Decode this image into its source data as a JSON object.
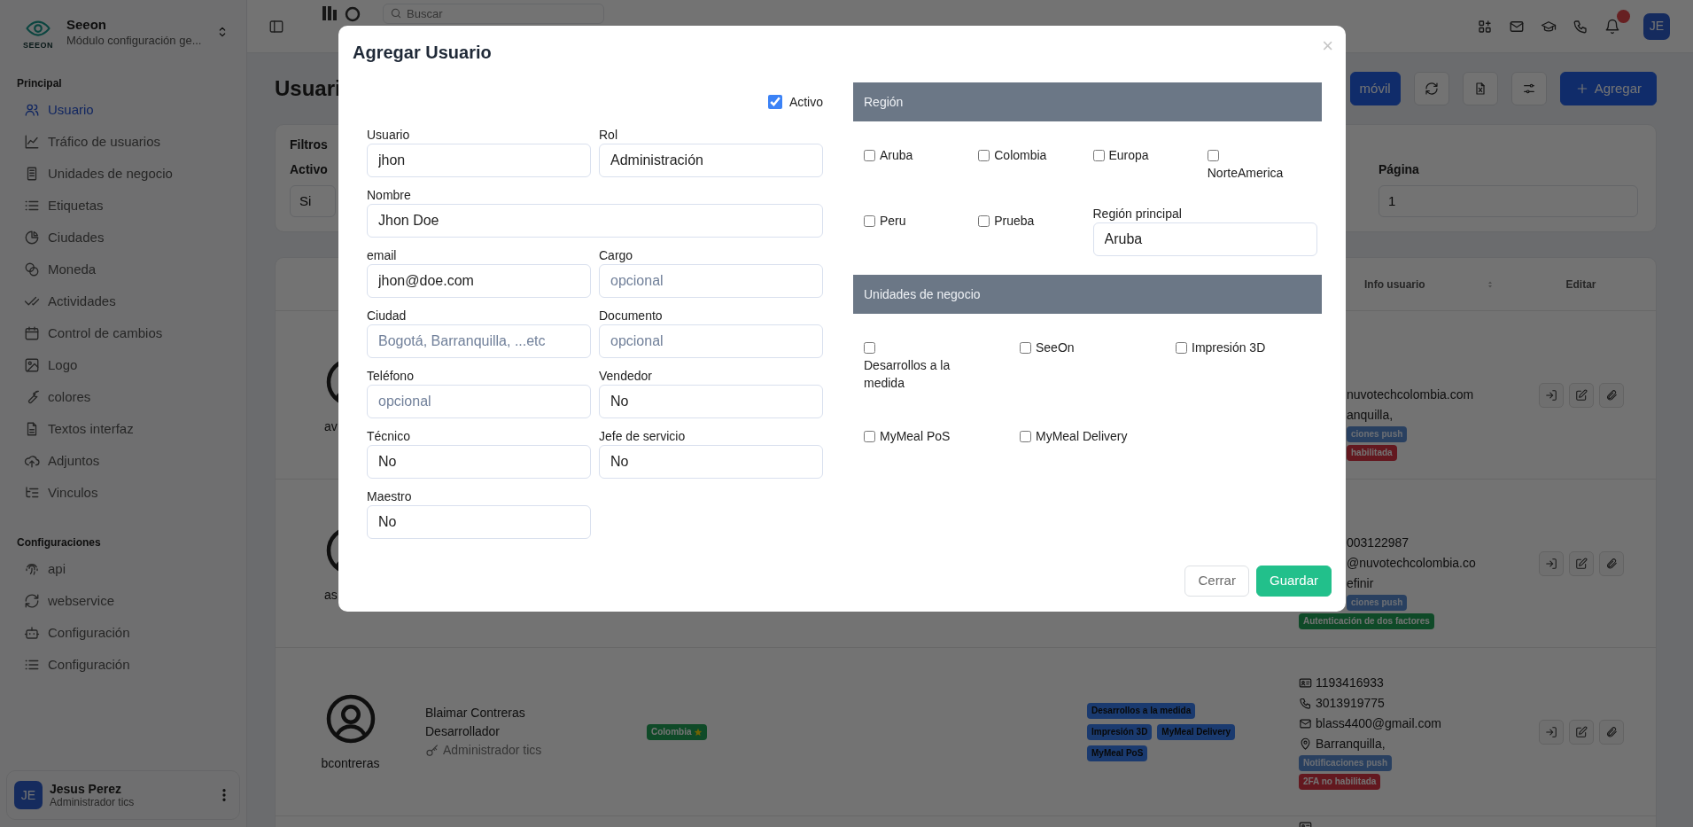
{
  "sidebar": {
    "brand": {
      "logo_text": "SEEON",
      "title": "Seeon",
      "subtitle": "Módulo configuración ge..."
    },
    "sections": [
      {
        "title": "Principal",
        "items": [
          {
            "label": "Usuario",
            "selected": true
          },
          {
            "label": "Tráfico de usuarios",
            "selected": false
          },
          {
            "label": "Unidades de negocio",
            "selected": false
          },
          {
            "label": "Etiquetas",
            "selected": false
          },
          {
            "label": "Ciudades",
            "selected": false
          },
          {
            "label": "Moneda",
            "selected": false
          },
          {
            "label": "Actividades",
            "selected": false
          },
          {
            "label": "Control de cambios",
            "selected": false
          },
          {
            "label": "Logo",
            "selected": false
          },
          {
            "label": "colores",
            "selected": false
          },
          {
            "label": "Textos interfaz",
            "selected": false
          },
          {
            "label": "Adjuntos",
            "selected": false
          },
          {
            "label": "Vinculos",
            "selected": false
          }
        ]
      },
      {
        "title": "Configuraciones",
        "items": [
          {
            "label": "api",
            "selected": false
          },
          {
            "label": "webservice",
            "selected": false
          },
          {
            "label": "Configuración",
            "selected": false
          },
          {
            "label": "Configuración",
            "selected": false
          }
        ]
      }
    ],
    "user": {
      "initials": "JE",
      "name": "Jesus Perez",
      "role": "Administrador tics"
    }
  },
  "topbar": {
    "search": {
      "placeholder": "Buscar"
    },
    "avatar": "JE"
  },
  "page": {
    "title": "Usuari",
    "buttons": [
      {
        "kind": "primary",
        "label": "móvil"
      },
      {
        "kind": "refresh"
      },
      {
        "kind": "excel"
      },
      {
        "kind": "settings"
      },
      {
        "kind": "add",
        "label": "Agregar"
      }
    ]
  },
  "filters": {
    "title": "Filtros",
    "fields": [
      {
        "label": "Activo",
        "value": "Si"
      },
      {
        "label": "Página",
        "value": "1"
      }
    ]
  },
  "table": {
    "columns": [
      {
        "label": "Info usuario",
        "sortable": true
      },
      {
        "label": "Editar",
        "sortable": false
      }
    ],
    "rows": [
      {
        "kind": "covered",
        "username": "av",
        "info": [
          {
            "text": "nuvotechcolombia.com",
            "cut": true
          },
          {
            "text": "anquilla,",
            "cut": true
          }
        ],
        "badges": [
          {
            "text": "ciones push",
            "kind": "info",
            "cut": true
          },
          {
            "text": "habilitada",
            "kind": "danger",
            "cut": true
          }
        ]
      },
      {
        "kind": "covered",
        "username": "as",
        "info": [
          {
            "text": "003122987",
            "cut": true
          },
          {
            "text": "@nuvotechcolombia.co",
            "cut": true
          },
          {
            "text": "efinir",
            "cut": true
          }
        ],
        "badges": [
          {
            "text": "ciones push",
            "kind": "info",
            "cut": true
          },
          {
            "text": "Autenticación de dos factores",
            "kind": "success"
          }
        ]
      },
      {
        "kind": "full",
        "username": "bcontreras",
        "name": "Blaimar Contreras",
        "position": "Desarrollador",
        "role": "Administrador tics",
        "regions": [
          {
            "label": "Colombia",
            "primary": true
          }
        ],
        "units": [
          "Desarrollos a la medida",
          "Impresión 3D",
          "MyMeal Delivery",
          "MyMeal PoS"
        ],
        "info": [
          {
            "kind": "document",
            "text": "1193416933"
          },
          {
            "kind": "phone",
            "text": "3013919775"
          },
          {
            "kind": "email",
            "text": "blass4400@gmail.com"
          },
          {
            "kind": "location",
            "text": "Barranquilla,"
          }
        ],
        "badges": [
          {
            "text": "Notificaciones push",
            "kind": "info"
          },
          {
            "text": "2FA no habilitada",
            "kind": "danger"
          }
        ]
      },
      {
        "kind": "clipped",
        "info": [
          {
            "kind": "document"
          }
        ]
      }
    ]
  },
  "modal": {
    "title": "Agregar Usuario",
    "close": "×",
    "active": {
      "label": "Activo",
      "checked": true
    },
    "fields": [
      {
        "label": "Usuario",
        "value": "jhon"
      },
      {
        "label": "Rol",
        "value": "Administración"
      },
      {
        "label": "Nombre",
        "value": "Jhon Doe",
        "wide": true
      },
      {
        "label": "email",
        "value": "jhon@doe.com"
      },
      {
        "label": "Cargo",
        "placeholder": "opcional"
      },
      {
        "label": "Ciudad",
        "placeholder": "Bogotá, Barranquilla, ...etc"
      },
      {
        "label": "Documento",
        "placeholder": "opcional"
      },
      {
        "label": "Teléfono",
        "placeholder": "opcional"
      },
      {
        "label": "Vendedor",
        "value": "No"
      },
      {
        "label": "Técnico",
        "value": "No"
      },
      {
        "label": "Jefe de servicio",
        "value": "No"
      },
      {
        "label": "Maestro",
        "value": "No"
      }
    ],
    "region": {
      "title": "Región",
      "options": [
        {
          "label": "Aruba",
          "checked": false
        },
        {
          "label": "Colombia",
          "checked": false
        },
        {
          "label": "Europa",
          "checked": false
        },
        {
          "label": "NorteAmerica",
          "checked": false
        },
        {
          "label": "Peru",
          "checked": false
        },
        {
          "label": "Prueba",
          "checked": false
        }
      ],
      "primary": {
        "label": "Región principal",
        "value": "Aruba"
      }
    },
    "units": {
      "title": "Unidades de negocio",
      "options": [
        {
          "label": "Desarrollos a la medida",
          "checked": false
        },
        {
          "label": "SeeOn",
          "checked": false
        },
        {
          "label": "Impresión 3D",
          "checked": false
        },
        {
          "label": "MyMeal PoS",
          "checked": false
        },
        {
          "label": "MyMeal Delivery",
          "checked": false
        }
      ]
    },
    "buttons": [
      {
        "kind": "secondary",
        "label": "Cerrar"
      },
      {
        "kind": "success",
        "label": "Guardar"
      }
    ]
  }
}
